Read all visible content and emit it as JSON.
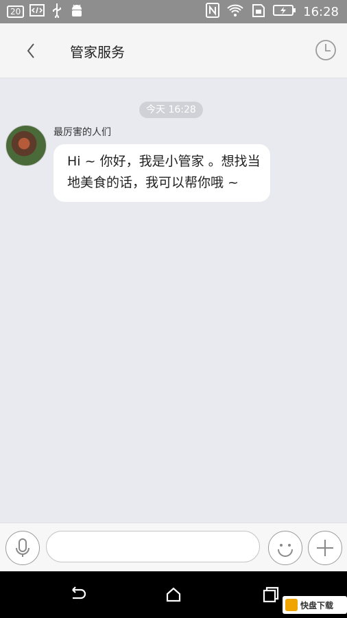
{
  "status_bar": {
    "notification_count": "20",
    "time": "16:28",
    "icons": [
      "notification-badge-icon",
      "code-icon",
      "usb-icon",
      "android-icon",
      "nfc-icon",
      "wifi-icon",
      "sim-card-icon",
      "battery-charging-icon"
    ]
  },
  "header": {
    "title": "管家服务",
    "back_icon": "chevron-left-icon",
    "history_icon": "clock-icon"
  },
  "chat": {
    "timestamp": "今天 16:28",
    "messages": [
      {
        "sender": "最厉害的人们",
        "text": "Hi ~ 你好，我是小管家 。想找当地美食的话，我可以帮你哦 ~"
      }
    ]
  },
  "input_bar": {
    "text_value": "",
    "placeholder": "",
    "icons": [
      "microphone-icon",
      "emoji-icon",
      "plus-icon"
    ]
  },
  "nav_bar": {
    "icons": [
      "back-icon",
      "home-icon",
      "recent-apps-icon"
    ]
  },
  "watermark": {
    "text": "快盘下载"
  }
}
